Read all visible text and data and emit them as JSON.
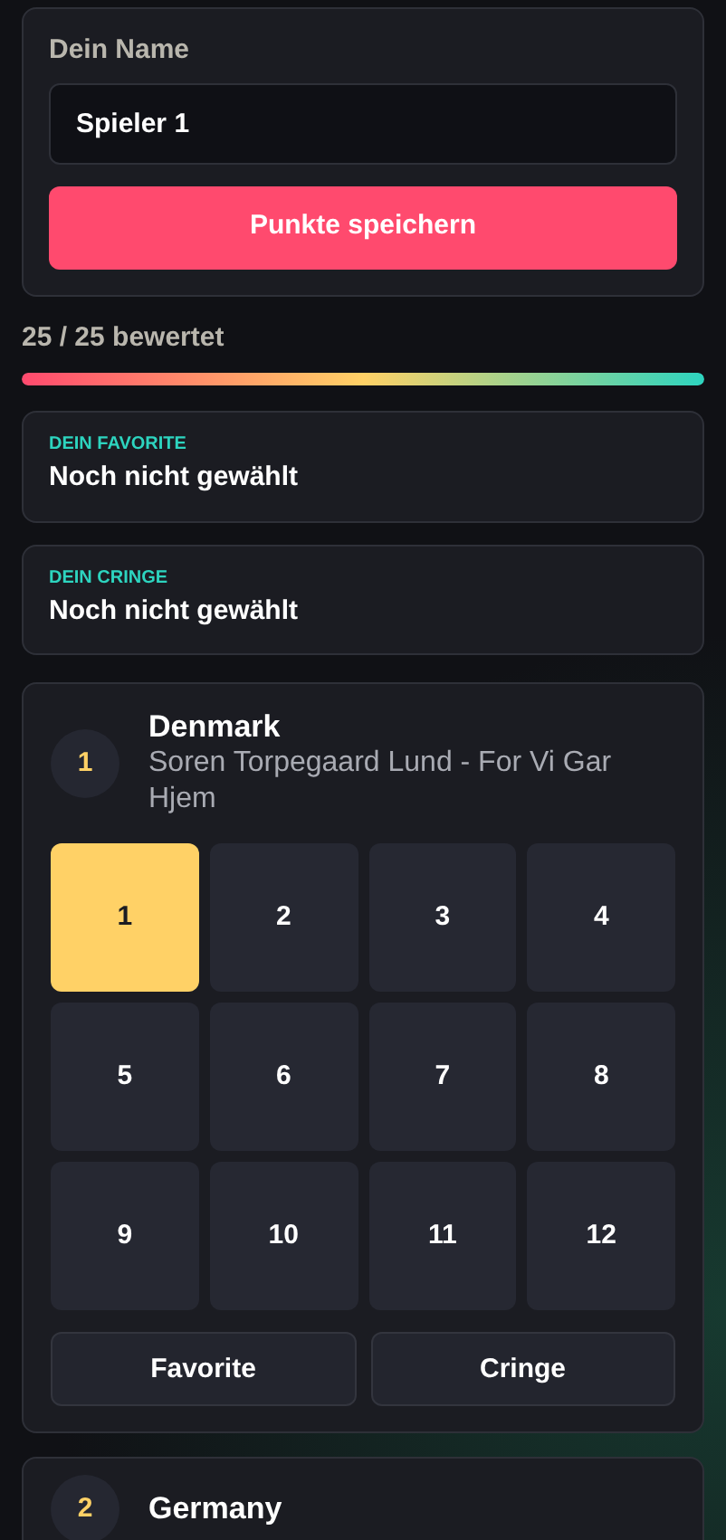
{
  "name_form": {
    "label": "Dein Name",
    "value": "Spieler 1",
    "save_button": "Punkte speichern"
  },
  "progress": {
    "text": "25 / 25 bewertet",
    "level": 1
  },
  "favorite": {
    "label": "DEIN FAVORITE",
    "value": "Noch nicht gewählt"
  },
  "cringe": {
    "label": "DEIN CRINGE",
    "value": "Noch nicht gewählt"
  },
  "entries": [
    {
      "rank": "1",
      "country": "Denmark",
      "song": "Soren Torpegaard Lund - For Vi Gar Hjem",
      "scores": [
        {
          "label": "1",
          "selected": true
        },
        {
          "label": "2",
          "selected": false
        },
        {
          "label": "3",
          "selected": false
        },
        {
          "label": "4",
          "selected": false
        },
        {
          "label": "5",
          "selected": false
        },
        {
          "label": "6",
          "selected": false
        },
        {
          "label": "7",
          "selected": false
        },
        {
          "label": "8",
          "selected": false
        },
        {
          "label": "9",
          "selected": false
        },
        {
          "label": "10",
          "selected": false
        },
        {
          "label": "11",
          "selected": false
        },
        {
          "label": "12",
          "selected": false
        }
      ],
      "buttons": [
        "Favorite",
        "Cringe"
      ]
    },
    {
      "rank": "2",
      "country": "Germany"
    }
  ]
}
